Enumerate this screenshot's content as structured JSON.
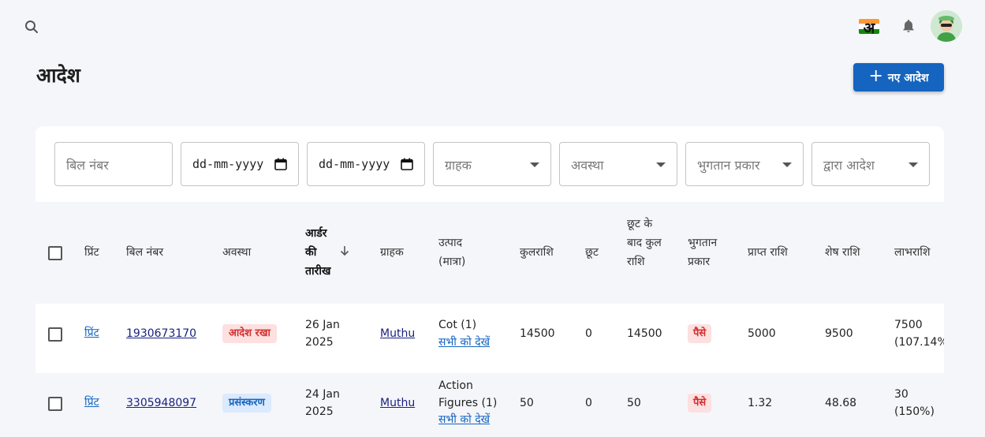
{
  "header": {
    "language_glyph": "अ",
    "page_title": "आदेश",
    "new_order_label": "नए आदेश"
  },
  "filters": {
    "bill_number_placeholder": "बिल नंबर",
    "date_from_placeholder": "dd-mm-yyyy",
    "date_to_placeholder": "dd-mm-yyyy",
    "customer_placeholder": "ग्राहक",
    "status_placeholder": "अवस्था",
    "payment_type_placeholder": "भुगतान प्रकार",
    "ordered_by_placeholder": "द्वारा आदेश"
  },
  "table": {
    "columns": {
      "print": "प्रिंट",
      "bill_number": "बिल नंबर",
      "status": "अवस्था",
      "order_date": "आर्डर की तारीख",
      "customer": "ग्राहक",
      "product": "उत्पाद",
      "product_qty": "(मात्रा)",
      "total": "कुलराशि",
      "discount": "छूट",
      "total_after_discount": "छूट के बाद कुल राशि",
      "payment_type": "भुगतान प्रकार",
      "received": "प्राप्त राशि",
      "balance": "शेष राशि",
      "profit": "लाभराशि"
    },
    "rows": [
      {
        "print": "प्रिंट",
        "bill_number": "1930673170",
        "status": "आदेश रखा",
        "date_line1": "26 Jan",
        "date_line2": "2025",
        "customer": "Muthu",
        "product_line1": "Cot (1)",
        "product_line2": "",
        "view_all": "सभी को देखें",
        "total": "14500",
        "discount": "0",
        "total_after_discount": "14500",
        "payment_type": "पैसे",
        "received": "5000",
        "balance": "9500",
        "profit_line1": "7500",
        "profit_line2": "(107.14%)"
      },
      {
        "print": "प्रिंट",
        "bill_number": "3305948097",
        "status": "प्रसंस्करण",
        "date_line1": "24 Jan",
        "date_line2": "2025",
        "customer": "Muthu",
        "product_line1": "Action",
        "product_line2": "Figures (1)",
        "view_all": "सभी को देखें",
        "total": "50",
        "discount": "0",
        "total_after_discount": "50",
        "payment_type": "पैसे",
        "received": "1.32",
        "balance": "48.68",
        "profit_line1": "30",
        "profit_line2": "(150%)"
      }
    ]
  },
  "colors": {
    "primary": "#1565c0",
    "background": "#f5f6fa",
    "status_placed": "#d32f2f",
    "status_processing": "#1565c0"
  }
}
